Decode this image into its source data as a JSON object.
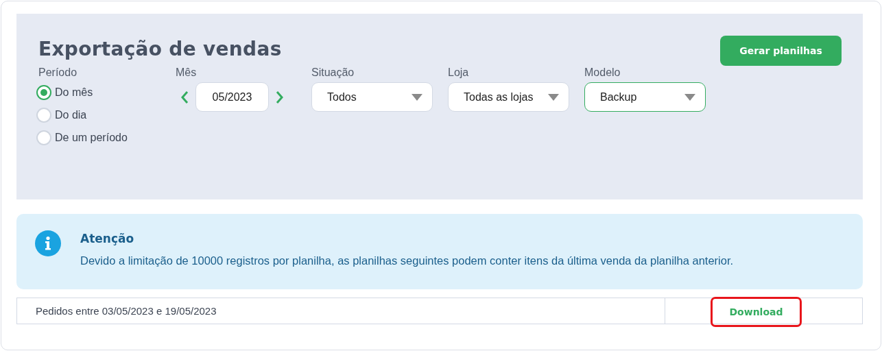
{
  "title": "Exportação de vendas",
  "generate_button": "Gerar planilhas",
  "period": {
    "label": "Período",
    "options": [
      {
        "label": "Do mês",
        "selected": true
      },
      {
        "label": "Do dia",
        "selected": false
      },
      {
        "label": "De um período",
        "selected": false
      }
    ]
  },
  "month": {
    "label": "Mês",
    "value": "05/2023"
  },
  "selects": [
    {
      "label": "Situação",
      "value": "Todos",
      "focused": false
    },
    {
      "label": "Loja",
      "value": "Todas as lojas",
      "focused": false
    },
    {
      "label": "Modelo",
      "value": "Backup",
      "focused": true
    }
  ],
  "alert": {
    "title": "Atenção",
    "text": "Devido a limitação de 10000 registros por planilha, as planilhas seguintes podem conter itens da última venda da planilha anterior."
  },
  "results": [
    {
      "description": "Pedidos entre 03/05/2023 e 19/05/2023",
      "action": "Download",
      "highlighted": true
    }
  ]
}
